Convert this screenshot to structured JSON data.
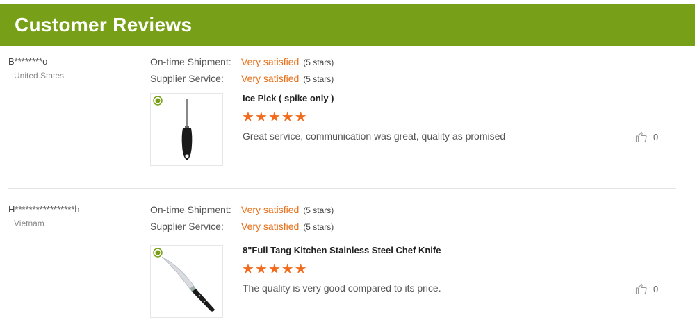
{
  "header": {
    "title": "Customer Reviews"
  },
  "reviews": [
    {
      "buyer": "B********o",
      "country": "United States",
      "shipment_label": "On-time Shipment:",
      "shipment_value": "Very satisfied",
      "shipment_stars": "(5 stars)",
      "service_label": "Supplier Service:",
      "service_value": "Very satisfied",
      "service_stars": "(5 stars)",
      "product": "Ice Pick ( spike only )",
      "rating": 5,
      "stars_display": "★★★★★",
      "comment": "Great service, communication was great, quality as promised",
      "helpful_count": "0",
      "product_icon": "ice-pick-image"
    },
    {
      "buyer": "H*****************h",
      "country": "Vietnam",
      "shipment_label": "On-time Shipment:",
      "shipment_value": "Very satisfied",
      "shipment_stars": "(5 stars)",
      "service_label": "Supplier Service:",
      "service_value": "Very satisfied",
      "service_stars": "(5 stars)",
      "product": "8\"Full Tang Kitchen Stainless Steel Chef Knife",
      "rating": 5,
      "stars_display": "★★★★★",
      "comment": "The quality is very good compared to its price.",
      "helpful_count": "0",
      "product_icon": "chef-knife-image"
    }
  ],
  "colors": {
    "header_bg": "#77a018",
    "accent": "#e8701a",
    "star": "#f26b1d"
  }
}
